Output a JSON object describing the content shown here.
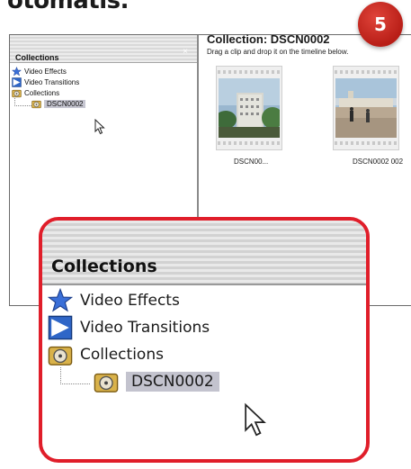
{
  "caption": "otomatis.",
  "step_number": "5",
  "window": {
    "left_pane": {
      "header_title": "Collections",
      "close_glyph": "×",
      "tree": [
        {
          "label": "Video Effects",
          "icon": "star-icon"
        },
        {
          "label": "Video Transitions",
          "icon": "transition-icon"
        },
        {
          "label": "Collections",
          "icon": "film-reel-icon"
        },
        {
          "label": "DSCN0002",
          "icon": "film-reel-icon",
          "selected": true
        }
      ]
    },
    "right_pane": {
      "title": "Collection: DSCN0002",
      "subtitle": "Drag a clip and drop it on the timeline below.",
      "clips": [
        {
          "caption": "DSCN00..."
        },
        {
          "caption": "DSCN0002 002"
        }
      ]
    }
  },
  "zoom": {
    "header_title": "Collections",
    "tree": [
      {
        "label": "Video Effects",
        "icon": "star-icon"
      },
      {
        "label": "Video Transitions",
        "icon": "transition-icon"
      },
      {
        "label": "Collections",
        "icon": "film-reel-icon"
      },
      {
        "label": "DSCN0002",
        "icon": "film-reel-icon",
        "selected": true
      }
    ]
  },
  "colors": {
    "badge": "#c8261e",
    "callout_border": "#e01e2a",
    "selection": "#c3c3ce"
  }
}
